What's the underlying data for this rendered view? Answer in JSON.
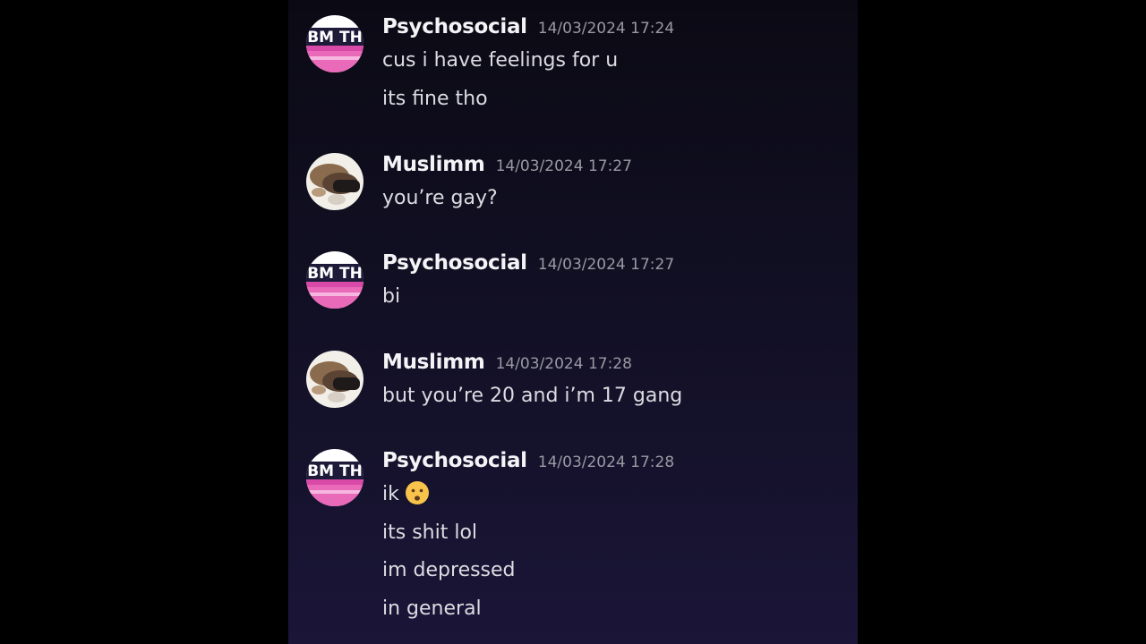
{
  "colors": {
    "page_background": "#000000",
    "panel_background_top": "#0b0a14",
    "panel_background_bottom": "#1b1538",
    "username": "#f4f4f7",
    "timestamp": "#9a9aa4",
    "message_text": "#dcdce2"
  },
  "messages": [
    {
      "author": "Psychosocial",
      "avatar_icon": "psychosocial-avatar",
      "timestamp": "14/03/2024 17:24",
      "lines": [
        "cus i have feelings for u",
        "its fine tho"
      ]
    },
    {
      "author": "Muslimm",
      "avatar_icon": "muslimm-avatar",
      "timestamp": "14/03/2024 17:27",
      "lines": [
        "you’re gay?"
      ]
    },
    {
      "author": "Psychosocial",
      "avatar_icon": "psychosocial-avatar",
      "timestamp": "14/03/2024 17:27",
      "lines": [
        "bi"
      ]
    },
    {
      "author": "Muslimm",
      "avatar_icon": "muslimm-avatar",
      "timestamp": "14/03/2024 17:28",
      "lines": [
        "but you’re 20 and i’m 17 gang"
      ]
    },
    {
      "author": "Psychosocial",
      "avatar_icon": "psychosocial-avatar",
      "timestamp": "14/03/2024 17:28",
      "lines": [
        "ik",
        "its shit lol",
        "im depressed",
        "in general"
      ],
      "emoji": "frowning-face-emoji"
    }
  ]
}
